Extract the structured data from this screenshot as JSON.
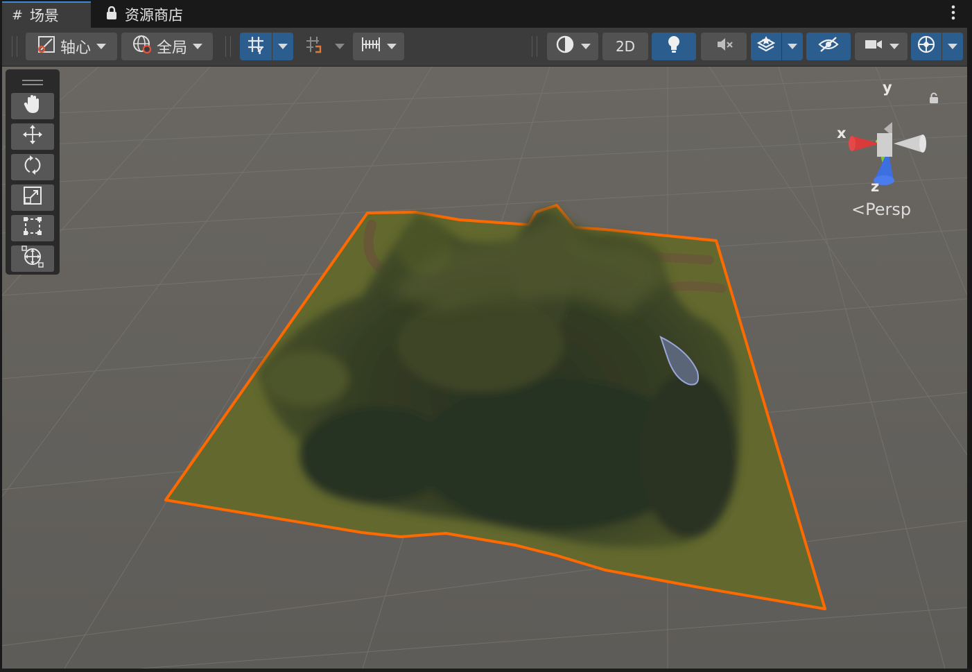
{
  "tabs": {
    "scene_label": "场景",
    "store_label": "资源商店"
  },
  "toolbar": {
    "pivot_label": "轴心",
    "global_label": "全局",
    "mode_2d_label": "2D"
  },
  "scene_view": {
    "projection_label": "Persp",
    "gizmo_axes": {
      "y": "y",
      "x": "x",
      "z": "z"
    }
  },
  "icons": [
    "scene-grid-icon",
    "lock-icon",
    "more-menu-icon",
    "pivot-icon",
    "globe-icon",
    "grid-snap-icon",
    "grid-visibility-icon",
    "increment-snap-icon",
    "shading-mode-icon",
    "lighting-icon",
    "audio-mute-icon",
    "effects-icon",
    "hidden-objects-icon",
    "camera-icon",
    "gizmos-icon",
    "hand-tool-icon",
    "move-tool-icon",
    "rotate-tool-icon",
    "scale-tool-icon",
    "rect-tool-icon",
    "transform-tool-icon"
  ],
  "colors": {
    "selection_outline": "#ff6a00",
    "terrain_light": "#62682e",
    "terrain_dark": "#283022",
    "active_button": "#2c5d8f",
    "axis_x": "#d93b3b",
    "axis_y": "#7ec43c",
    "axis_z": "#3d6fe0"
  }
}
